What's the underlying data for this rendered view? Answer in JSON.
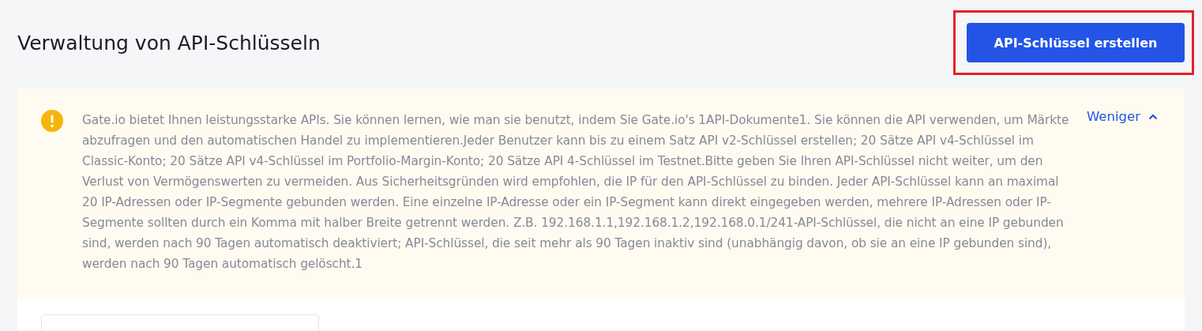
{
  "page": {
    "title": "Verwaltung von API-Schlüsseln"
  },
  "create_button": {
    "label": "API-Schlüssel erstellen",
    "highlighted": true
  },
  "notice": {
    "text": "Gate.io bietet Ihnen leistungsstarke APIs. Sie können lernen, wie man sie benutzt, indem Sie Gate.io's 1API-Dokumente1. Sie können die API verwenden, um Märkte abzufragen und den automatischen Handel zu implementieren.Jeder Benutzer kann bis zu einem Satz API v2-Schlüssel erstellen; 20 Sätze API v4-Schlüssel im Classic-Konto; 20 Sätze API v4-Schlüssel im Portfolio-Margin-Konto; 20 Sätze API 4-Schlüssel im Testnet.Bitte geben Sie Ihren API-Schlüssel nicht weiter, um den Verlust von Vermögenswerten zu vermeiden. Aus Sicherheitsgründen wird empfohlen, die IP für den API-Schlüssel zu binden. Jeder API-Schlüssel kann an maximal 20 IP-Adressen oder IP-Segmente gebunden werden. Eine einzelne IP-Adresse oder ein IP-Segment kann direkt eingegeben werden, mehrere IP-Adressen oder IP-Segmente sollten durch ein Komma mit halber Breite getrennt werden. Z.B. 192.168.1.1,192.168.1.2,192.168.0.1/241-API-Schlüssel, die nicht an eine IP gebunden sind, werden nach 90 Tagen automatisch deaktiviert; API-Schlüssel, die seit mehr als 90 Tagen inaktiv sind (unabhängig davon, ob sie an eine IP gebunden sind), werden nach 90 Tagen automatisch gelöscht.1",
    "toggle": "Weniger",
    "expanded": true
  }
}
